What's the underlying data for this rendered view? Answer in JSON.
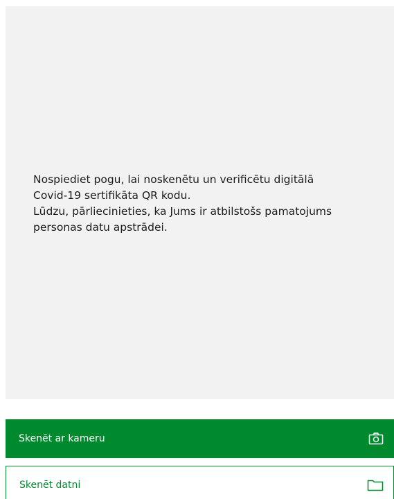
{
  "info": {
    "lines": [
      "Nospiediet pogu, lai noskenētu un verificētu digitālā",
      "Covid-19 sertifikāta QR kodu.",
      "Lūdzu, pārliecinieties, ka Jums ir atbilstošs pamatojums",
      "personas datu apstrādei."
    ]
  },
  "actions": {
    "scan_camera_label": "Skenēt ar kameru",
    "scan_camera_icon": "camera-icon",
    "scan_file_label": "Skenēt datni",
    "scan_file_icon": "folder-icon"
  },
  "colors": {
    "accent": "#008a2e",
    "panel_bg": "#f2f2f2",
    "text": "#1b1b1b"
  }
}
